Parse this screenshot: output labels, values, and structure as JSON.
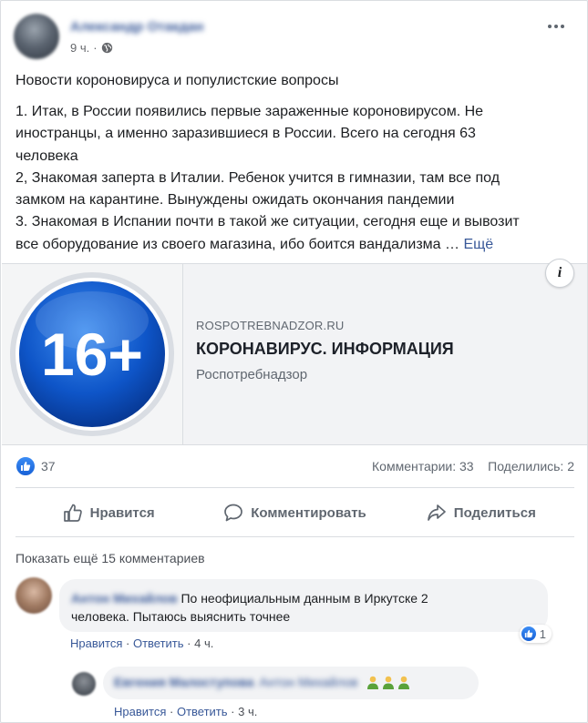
{
  "post": {
    "time": "9 ч.",
    "author": "Александр Отакдан",
    "title": "Новости короновируса и популистские вопросы",
    "body_lines": [
      "1. Итак, в России появились первые зараженные короновирусом. Не",
      "иностранцы, а именно заразившиеся в России. Всего на сегодня 63",
      "человека",
      "2, Знакомая заперта в Италии. Ребенок учится в гимназии, там все под",
      "замком на карантине. Вынуждены ожидать окончания пандемии",
      "3. Знакомая в Испании почти в такой же ситуации, сегодня еще и вывозит",
      "все оборудование из своего магазина, ибо боится вандализма … "
    ],
    "see_more": "Ещё"
  },
  "preview": {
    "badge_text": "16+",
    "domain": "ROSPOTREBNADZOR.RU",
    "title": "КОРОНАВИРУС. ИНФОРМАЦИЯ",
    "source": "Роспотребнадзор",
    "info_label": "i"
  },
  "reactions": {
    "like_count": "37",
    "comments": "Комментарии: 33",
    "shares": "Поделились: 2"
  },
  "actions": {
    "like": "Нравится",
    "comment": "Комментировать",
    "share": "Поделиться"
  },
  "comments": {
    "show_more": "Показать ещё 15 комментариев",
    "items": [
      {
        "author": "Антон Михайлов",
        "text": "По неофициальным данным в Иркутске 2",
        "text2": "человека. Пытаюсь выяснить точнее",
        "reaction_count": "1",
        "like": "Нравится",
        "reply": "Ответить",
        "time": "4 ч."
      },
      {
        "author": "Евгения Малоступова",
        "tag": "Антон Михайлов",
        "like": "Нравится",
        "reply": "Ответить",
        "time": "3 ч."
      }
    ]
  },
  "colors": {
    "link": "#385898",
    "like_blue": "#1877f2",
    "badge_blue": "#0a4fc4"
  }
}
